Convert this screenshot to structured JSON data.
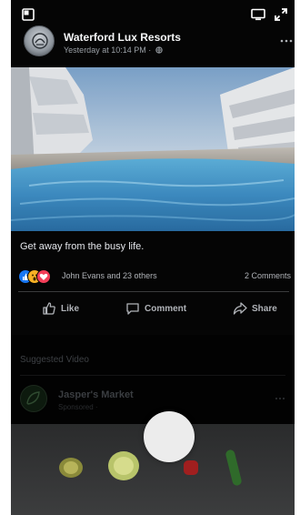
{
  "post": {
    "author": "Waterford Lux Resorts",
    "timestamp": "Yesterday at 10:14 PM ·",
    "caption": "Get away from the busy life."
  },
  "reactions": {
    "icons": [
      "like",
      "wow",
      "love"
    ],
    "summary": "John Evans and 23 others",
    "comments": "2 Comments"
  },
  "actions": {
    "like": "Like",
    "comment": "Comment",
    "share": "Share"
  },
  "suggested": {
    "title": "Suggested Video",
    "page_name": "Jasper's Market",
    "sponsored": "Sponsored ·"
  },
  "colors": {
    "background": "#050505",
    "text_primary": "#e4e6eb",
    "text_secondary": "#b0b3b8",
    "like_blue": "#1877f2",
    "love_red": "#f33e58",
    "wow_yellow": "#f7b125"
  }
}
